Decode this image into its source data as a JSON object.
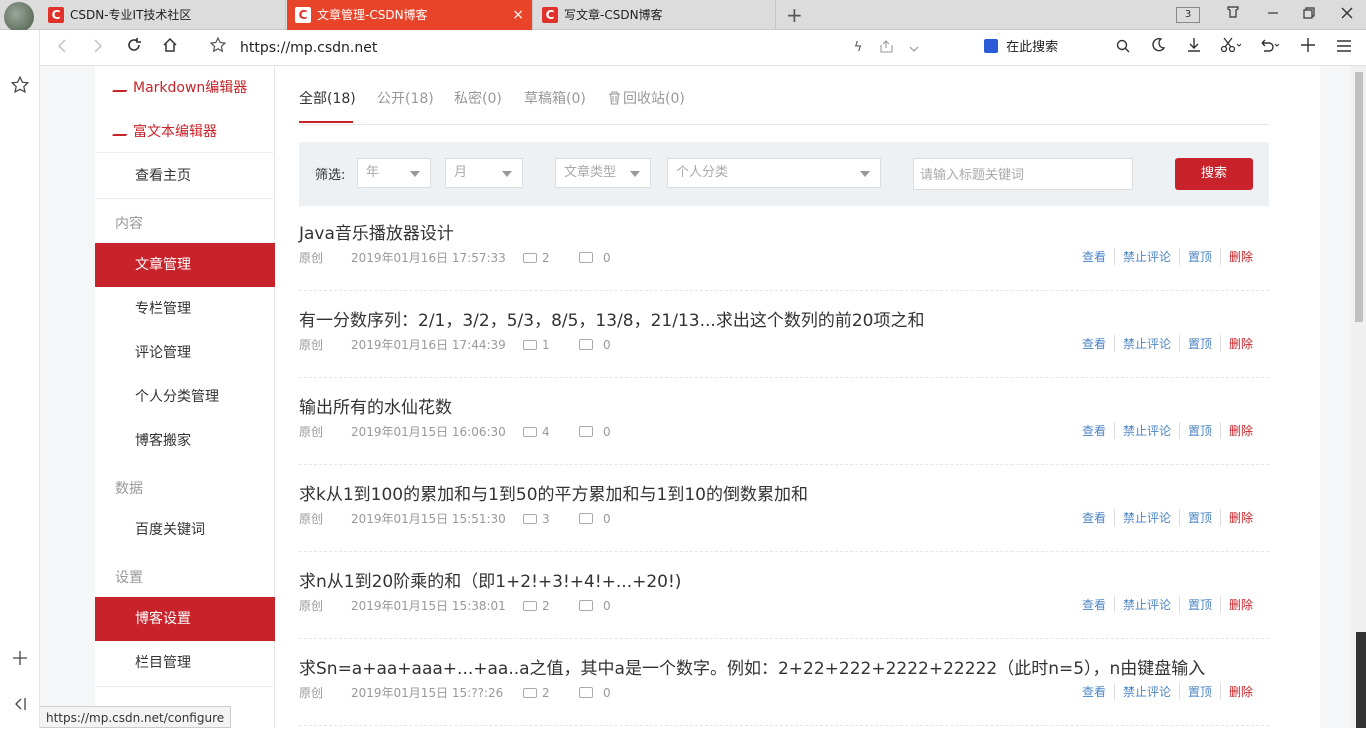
{
  "browser": {
    "tabs": [
      {
        "label": "CSDN-专业IT技术社区"
      },
      {
        "label": "文章管理-CSDN博客",
        "close": "×"
      },
      {
        "label": "写文章-CSDN博客"
      }
    ],
    "tab_count": "3",
    "url": "https://mp.csdn.net",
    "search_placeholder": "在此搜索",
    "status_url": "https://mp.csdn.net/configure"
  },
  "sidebar": {
    "editors": [
      {
        "label": "Markdown编辑器"
      },
      {
        "label": "富文本编辑器"
      }
    ],
    "home": "查看主页",
    "sections": {
      "content": "内容",
      "data": "数据",
      "settings": "设置"
    },
    "content_items": [
      {
        "label": "文章管理"
      },
      {
        "label": "专栏管理"
      },
      {
        "label": "评论管理"
      },
      {
        "label": "个人分类管理"
      },
      {
        "label": "博客搬家"
      }
    ],
    "data_items": [
      {
        "label": "百度关键词"
      }
    ],
    "settings_items": [
      {
        "label": "博客设置"
      },
      {
        "label": "栏目管理"
      }
    ]
  },
  "main": {
    "tabs": [
      {
        "label": "全部(18)"
      },
      {
        "label": "公开(18)"
      },
      {
        "label": "私密(0)"
      },
      {
        "label": "草稿箱(0)"
      },
      {
        "label": "回收站(0)"
      }
    ],
    "filter": {
      "label": "筛选:",
      "year": "年",
      "month": "月",
      "type": "文章类型",
      "category": "个人分类",
      "keyword_placeholder": "请输入标题关键词",
      "search_button": "搜索"
    },
    "actions": {
      "view": "查看",
      "disable_comment": "禁止评论",
      "pin": "置顶",
      "delete": "删除"
    },
    "articles": [
      {
        "title": "Java音乐播放器设计",
        "type": "原创",
        "date": "2019年01月16日 17:57:33",
        "views": "2",
        "comments": "0"
      },
      {
        "title": "有一分数序列：2/1，3/2，5/3，8/5，13/8，21/13...求出这个数列的前20项之和",
        "type": "原创",
        "date": "2019年01月16日 17:44:39",
        "views": "1",
        "comments": "0"
      },
      {
        "title": "输出所有的水仙花数",
        "type": "原创",
        "date": "2019年01月15日 16:06:30",
        "views": "4",
        "comments": "0"
      },
      {
        "title": "求k从1到100的累加和与1到50的平方累加和与1到10的倒数累加和",
        "type": "原创",
        "date": "2019年01月15日 15:51:30",
        "views": "3",
        "comments": "0"
      },
      {
        "title": "求n从1到20阶乘的和（即1+2!+3!+4!+...+20!)",
        "type": "原创",
        "date": "2019年01月15日 15:38:01",
        "views": "2",
        "comments": "0"
      },
      {
        "title": "求Sn=a+aa+aaa+...+aa..a之值，其中a是一个数字。例如：2+22+222+2222+22222（此时n=5），n由键盘输入",
        "type": "原创",
        "date": "2019年01月15日 15:??:26",
        "views": "2",
        "comments": "0"
      }
    ]
  }
}
